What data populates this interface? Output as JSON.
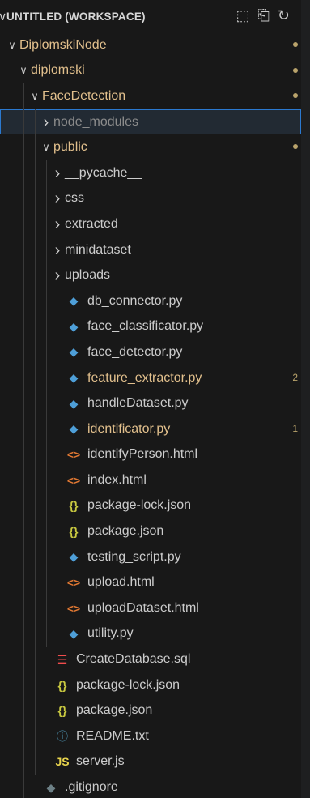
{
  "explorer": {
    "title": "UNTITLED (WORKSPACE)",
    "actions": [
      "new-file-icon",
      "new-folder-icon",
      "refresh-icon"
    ]
  },
  "tree": [
    {
      "label": "DiplomskiNode",
      "kind": "folder-open",
      "depth": 0,
      "modified": true
    },
    {
      "label": "diplomski",
      "kind": "folder-open",
      "depth": 1,
      "modified": true
    },
    {
      "label": "FaceDetection",
      "kind": "folder-open",
      "depth": 2,
      "modified": true
    },
    {
      "label": "node_modules",
      "kind": "folder-closed",
      "depth": 3,
      "muted": true,
      "selected": true
    },
    {
      "label": "public",
      "kind": "folder-open",
      "depth": 3,
      "modified": true
    },
    {
      "label": "__pycache__",
      "kind": "folder-closed",
      "depth": 4
    },
    {
      "label": "css",
      "kind": "folder-closed",
      "depth": 4
    },
    {
      "label": "extracted",
      "kind": "folder-closed",
      "depth": 4
    },
    {
      "label": "minidataset",
      "kind": "folder-closed",
      "depth": 4
    },
    {
      "label": "uploads",
      "kind": "folder-closed",
      "depth": 4
    },
    {
      "label": "db_connector.py",
      "kind": "python",
      "depth": 4
    },
    {
      "label": "face_classificator.py",
      "kind": "python",
      "depth": 4
    },
    {
      "label": "face_detector.py",
      "kind": "python",
      "depth": 4
    },
    {
      "label": "feature_extractor.py",
      "kind": "python",
      "depth": 4,
      "modified": true,
      "badge": "2"
    },
    {
      "label": "handleDataset.py",
      "kind": "python",
      "depth": 4
    },
    {
      "label": "identificator.py",
      "kind": "python",
      "depth": 4,
      "modified": true,
      "badge": "1"
    },
    {
      "label": "identifyPerson.html",
      "kind": "html",
      "depth": 4
    },
    {
      "label": "index.html",
      "kind": "html",
      "depth": 4
    },
    {
      "label": "package-lock.json",
      "kind": "json",
      "depth": 4
    },
    {
      "label": "package.json",
      "kind": "json",
      "depth": 4
    },
    {
      "label": "testing_script.py",
      "kind": "python",
      "depth": 4
    },
    {
      "label": "upload.html",
      "kind": "html",
      "depth": 4
    },
    {
      "label": "uploadDataset.html",
      "kind": "html",
      "depth": 4
    },
    {
      "label": "utility.py",
      "kind": "python",
      "depth": 4
    },
    {
      "label": "CreateDatabase.sql",
      "kind": "sql",
      "depth": 3
    },
    {
      "label": "package-lock.json",
      "kind": "json",
      "depth": 3
    },
    {
      "label": "package.json",
      "kind": "json",
      "depth": 3
    },
    {
      "label": "README.txt",
      "kind": "info",
      "depth": 3
    },
    {
      "label": "server.js",
      "kind": "js",
      "depth": 3
    },
    {
      "label": ".gitignore",
      "kind": "git",
      "depth": 2
    }
  ],
  "colors": {
    "modified": "#e2c08d",
    "selection_border": "#2b79d0"
  }
}
